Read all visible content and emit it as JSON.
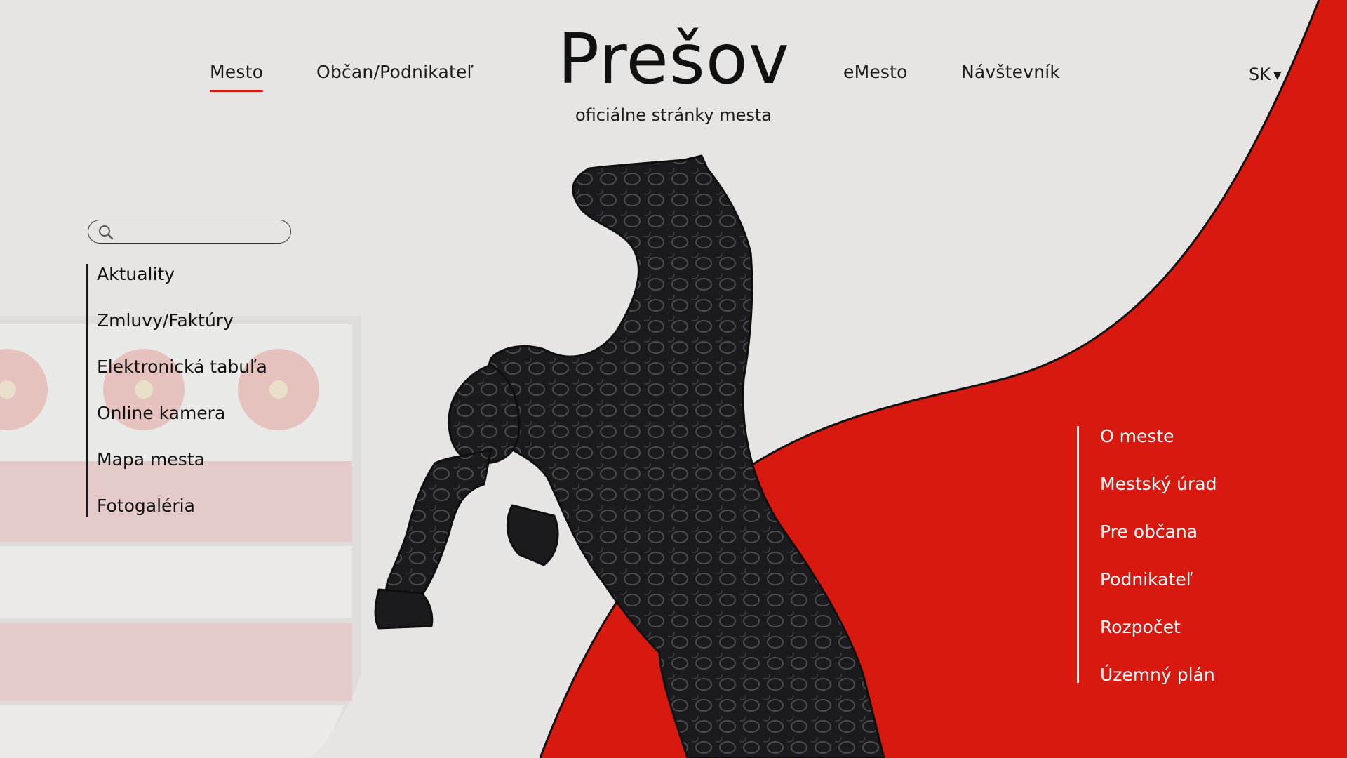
{
  "colors": {
    "background": "#e6e5e4",
    "accent": "#d7190f",
    "text": "#111111",
    "coat_of_arms_red": "#e6b9b6"
  },
  "header": {
    "nav_left": [
      {
        "label": "Mesto",
        "active": true
      },
      {
        "label": "Občan/Podnikateľ",
        "active": false
      }
    ],
    "nav_right": [
      {
        "label": "eMesto"
      },
      {
        "label": "Návštevník"
      }
    ],
    "logo": {
      "title": "Prešov",
      "subtitle": "oficiálne stránky mesta"
    },
    "language": {
      "value": "SK"
    }
  },
  "search": {
    "value": "",
    "placeholder": "",
    "icon": "search-icon"
  },
  "left_menu": {
    "items": [
      {
        "label": "Aktuality"
      },
      {
        "label": "Zmluvy/Faktúry"
      },
      {
        "label": "Elektronická tabuľa"
      },
      {
        "label": "Online kamera"
      },
      {
        "label": "Mapa mesta"
      },
      {
        "label": "Fotogaléria"
      }
    ]
  },
  "right_menu": {
    "items": [
      {
        "label": "O meste"
      },
      {
        "label": "Mestský úrad"
      },
      {
        "label": "Pre občana"
      },
      {
        "label": "Podnikateľ"
      },
      {
        "label": "Rozpočet"
      },
      {
        "label": "Územný plán"
      }
    ]
  },
  "hero": {
    "image": "horse-sculpture",
    "background_image": "coat-of-arms"
  }
}
